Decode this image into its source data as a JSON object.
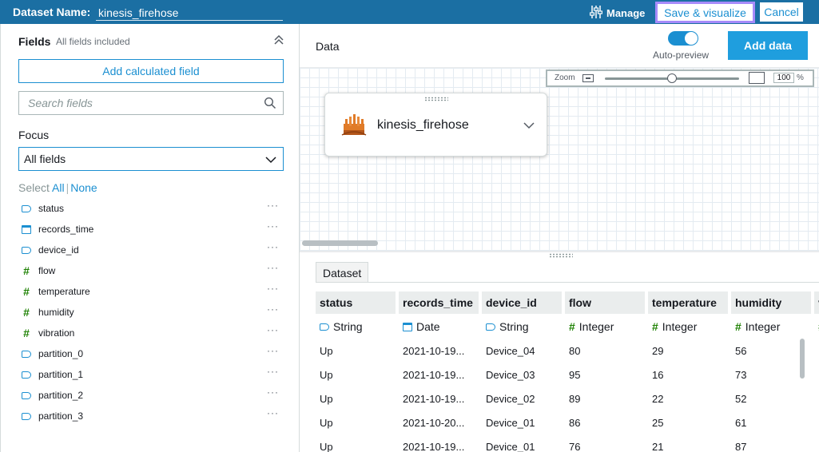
{
  "topbar": {
    "dataset_label": "Dataset Name:",
    "dataset_name": "kinesis_firehose",
    "manage_label": "Manage",
    "save_label": "Save & visualize",
    "cancel_label": "Cancel",
    "bg_color": "#1b6fa3",
    "accent_outline": "#a78bfa"
  },
  "fields_panel": {
    "title": "Fields",
    "subtitle": "All fields included",
    "add_calculated_label": "Add calculated field",
    "search_placeholder": "Search fields",
    "focus_label": "Focus",
    "focus_value": "All fields",
    "select_label": "Select",
    "select_all": "All",
    "select_none": "None",
    "more_label": "···",
    "items": [
      {
        "name": "status",
        "type": "string-icon"
      },
      {
        "name": "records_time",
        "type": "calendar-icon"
      },
      {
        "name": "device_id",
        "type": "string-icon"
      },
      {
        "name": "flow",
        "type": "hash-icon"
      },
      {
        "name": "temperature",
        "type": "hash-icon"
      },
      {
        "name": "humidity",
        "type": "hash-icon"
      },
      {
        "name": "vibration",
        "type": "hash-icon"
      },
      {
        "name": "partition_0",
        "type": "string-icon"
      },
      {
        "name": "partition_1",
        "type": "string-icon"
      },
      {
        "name": "partition_2",
        "type": "string-icon"
      },
      {
        "name": "partition_3",
        "type": "string-icon"
      }
    ]
  },
  "data_panel": {
    "title": "Data",
    "auto_preview_label": "Auto-preview",
    "auto_preview_on": true,
    "add_data_label": "Add data",
    "zoom": {
      "label": "Zoom",
      "value": "100",
      "unit": "%",
      "level_fraction": 0.5
    },
    "node": {
      "name": "kinesis_firehose",
      "icon": "kinesis-icon"
    },
    "tab_label": "Dataset",
    "columns": [
      {
        "name": "status",
        "type": "String",
        "icon": "string-icon"
      },
      {
        "name": "records_time",
        "type": "Date",
        "icon": "calendar-icon"
      },
      {
        "name": "device_id",
        "type": "String",
        "icon": "string-icon"
      },
      {
        "name": "flow",
        "type": "Integer",
        "icon": "hash-icon"
      },
      {
        "name": "temperature",
        "type": "Integer",
        "icon": "hash-icon"
      },
      {
        "name": "humidity",
        "type": "Integer",
        "icon": "hash-icon"
      },
      {
        "name": "vi",
        "type": "",
        "icon": "hash-icon"
      }
    ],
    "rows": [
      [
        "Up",
        "2021-10-19...",
        "Device_04",
        "80",
        "29",
        "56"
      ],
      [
        "Up",
        "2021-10-19...",
        "Device_03",
        "95",
        "16",
        "73"
      ],
      [
        "Up",
        "2021-10-19...",
        "Device_02",
        "89",
        "22",
        "52"
      ],
      [
        "Up",
        "2021-10-20...",
        "Device_01",
        "86",
        "25",
        "61"
      ],
      [
        "Up",
        "2021-10-19...",
        "Device_01",
        "76",
        "21",
        "87"
      ]
    ]
  }
}
